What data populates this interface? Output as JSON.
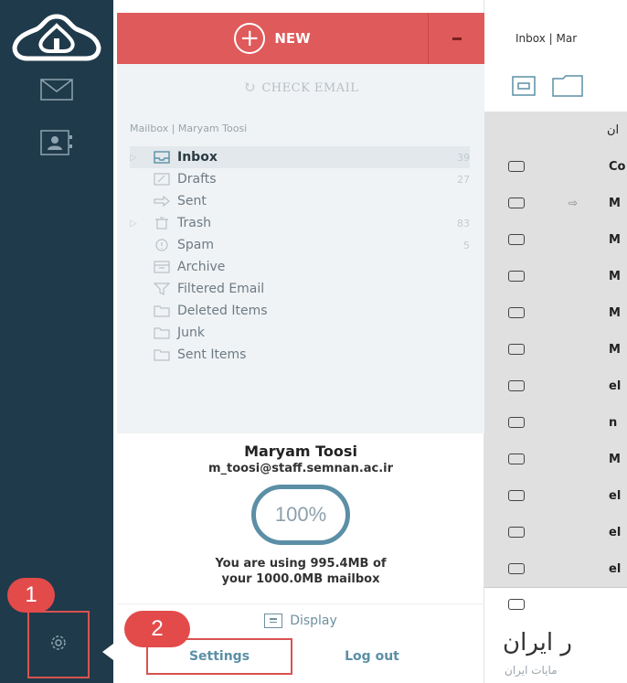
{
  "new_button": {
    "label": "NEW"
  },
  "check_email": {
    "label": "CHECK EMAIL"
  },
  "mailbox": {
    "title": "Mailbox | Maryam Toosi",
    "folders": [
      {
        "name": "Inbox",
        "count": "39",
        "icon": "inbox-icon",
        "expandable": true,
        "active": true
      },
      {
        "name": "Drafts",
        "count": "27",
        "icon": "drafts-icon",
        "expandable": false,
        "active": false
      },
      {
        "name": "Sent",
        "count": "",
        "icon": "sent-icon",
        "expandable": false,
        "active": false
      },
      {
        "name": "Trash",
        "count": "83",
        "icon": "trash-icon",
        "expandable": true,
        "active": false
      },
      {
        "name": "Spam",
        "count": "5",
        "icon": "spam-icon",
        "expandable": false,
        "active": false
      },
      {
        "name": "Archive",
        "count": "",
        "icon": "archive-icon",
        "expandable": false,
        "active": false
      },
      {
        "name": "Filtered Email",
        "count": "",
        "icon": "filter-icon",
        "expandable": false,
        "active": false
      },
      {
        "name": "Deleted Items",
        "count": "",
        "icon": "folder-icon",
        "expandable": false,
        "active": false
      },
      {
        "name": "Junk",
        "count": "",
        "icon": "folder-icon",
        "expandable": false,
        "active": false
      },
      {
        "name": "Sent Items",
        "count": "",
        "icon": "folder-icon",
        "expandable": false,
        "active": false
      }
    ]
  },
  "profile": {
    "name": "Maryam Toosi",
    "email": "m_toosi@staff.semnan.ac.ir",
    "quota_percent": "100%",
    "usage_line1": "You are using 995.4MB of",
    "usage_line2": "your 1000.0MB mailbox"
  },
  "display_button": {
    "label": "Display"
  },
  "bottom_links": {
    "settings": "Settings",
    "logout": "Log out"
  },
  "annotations": {
    "badge1": "1",
    "badge2": "2"
  },
  "message_list": {
    "header": "Inbox | Mar",
    "rows": [
      {
        "text": "ان",
        "forwarded": false,
        "first": true
      },
      {
        "text": "Co",
        "forwarded": false,
        "first": false
      },
      {
        "text": "M",
        "forwarded": true,
        "first": false
      },
      {
        "text": "M",
        "forwarded": false,
        "first": false
      },
      {
        "text": "M",
        "forwarded": false,
        "first": false
      },
      {
        "text": "M",
        "forwarded": false,
        "first": false
      },
      {
        "text": "M",
        "forwarded": false,
        "first": false
      },
      {
        "text": "el",
        "forwarded": false,
        "first": false
      },
      {
        "text": "n",
        "forwarded": false,
        "first": false
      },
      {
        "text": "M",
        "forwarded": false,
        "first": false
      },
      {
        "text": "el",
        "forwarded": false,
        "first": false
      },
      {
        "text": "el",
        "forwarded": false,
        "first": false
      },
      {
        "text": "el",
        "forwarded": false,
        "first": false
      }
    ],
    "brand_title": "ر ایران",
    "brand_subtitle": "مایات ایران"
  },
  "colors": {
    "rail": "#1f3a4a",
    "new_button": "#df5a5a",
    "accent": "#5b8fa6",
    "annotation": "#e34b4b",
    "panel_bg": "#f0f3f5",
    "list_bg": "#e0e0e0"
  }
}
